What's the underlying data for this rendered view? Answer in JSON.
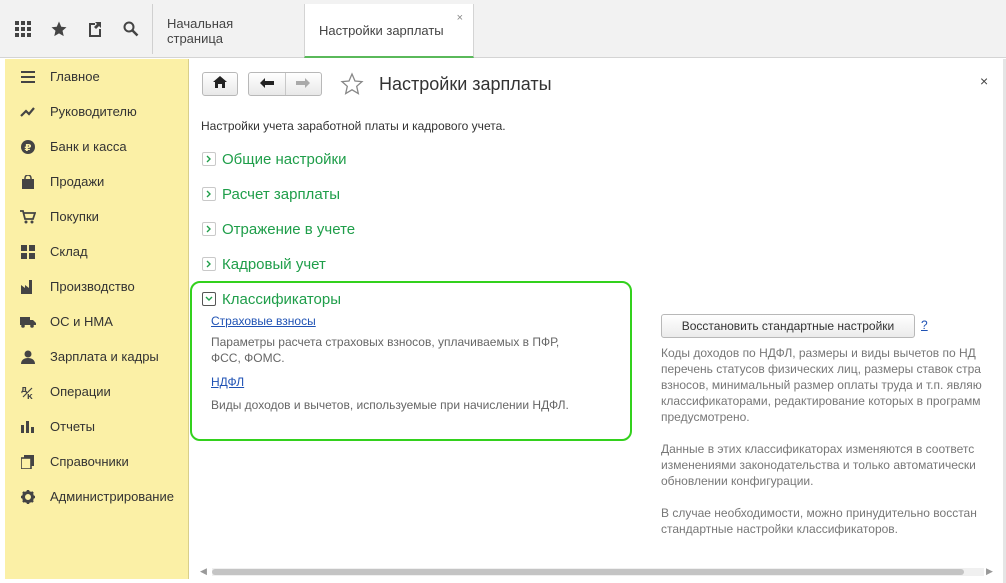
{
  "topbar": {
    "icons": [
      "apps-grid-icon",
      "star-icon",
      "history-icon",
      "search-icon"
    ],
    "tabs": [
      {
        "label": "Начальная страница"
      },
      {
        "label": "Настройки зарплаты",
        "close": "×"
      }
    ]
  },
  "sidebar": {
    "items": [
      {
        "label": "Главное",
        "icon": "menu-icon"
      },
      {
        "label": "Руководителю",
        "icon": "trend-icon"
      },
      {
        "label": "Банк и касса",
        "icon": "ruble-icon"
      },
      {
        "label": "Продажи",
        "icon": "bag-icon"
      },
      {
        "label": "Покупки",
        "icon": "cart-icon"
      },
      {
        "label": "Склад",
        "icon": "warehouse-icon"
      },
      {
        "label": "Производство",
        "icon": "factory-icon"
      },
      {
        "label": "ОС и НМА",
        "icon": "truck-icon"
      },
      {
        "label": "Зарплата и кадры",
        "icon": "person-icon"
      },
      {
        "label": "Операции",
        "icon": "operations-icon"
      },
      {
        "label": "Отчеты",
        "icon": "bar-chart-icon"
      },
      {
        "label": "Справочники",
        "icon": "book-icon"
      },
      {
        "label": "Администрирование",
        "icon": "gear-icon"
      }
    ]
  },
  "main": {
    "title": "Настройки зарплаты",
    "close": "×",
    "subtitle": "Настройки учета заработной платы и кадрового учета.",
    "sections": [
      {
        "label": "Общие настройки",
        "toggle": "›"
      },
      {
        "label": "Расчет зарплаты",
        "toggle": "›"
      },
      {
        "label": "Отражение в учете",
        "toggle": "›"
      },
      {
        "label": "Кадровый учет",
        "toggle": "›"
      },
      {
        "label": "Классификаторы",
        "toggle": "⌄"
      }
    ],
    "classifiers": {
      "insurance_link": "Страховые взносы",
      "insurance_desc_1": "Параметры расчета страховых взносов, уплачиваемых в ПФР,",
      "insurance_desc_2": "ФСС, ФОМС.",
      "ndfl_link": "НДФЛ",
      "ndfl_desc": "Виды доходов и вычетов, используемые при начислении НДФЛ."
    },
    "restore_button": "Восстановить стандартные настройки",
    "help_link": "?",
    "info_lines": [
      "Коды доходов по НДФЛ, размеры и виды вычетов по НД",
      "перечень статусов физических лиц, размеры ставок стра",
      "взносов, минимальный размер оплаты труда и т.п. являю",
      "классификаторами, редактирование которых в программ",
      "предусмотрено.",
      "",
      "Данные в этих классификаторах изменяются в соответс",
      "изменениями законодательства и только автоматически",
      "обновлении конфигурации.",
      "",
      "В случае необходимости, можно принудительно восстан",
      "стандартные настройки классификаторов."
    ]
  },
  "colors": {
    "sidebar_bg": "#fbf0a6",
    "section_green": "#1f9e4a",
    "highlight_green": "#33d11d",
    "link_blue": "#1f52b4"
  }
}
